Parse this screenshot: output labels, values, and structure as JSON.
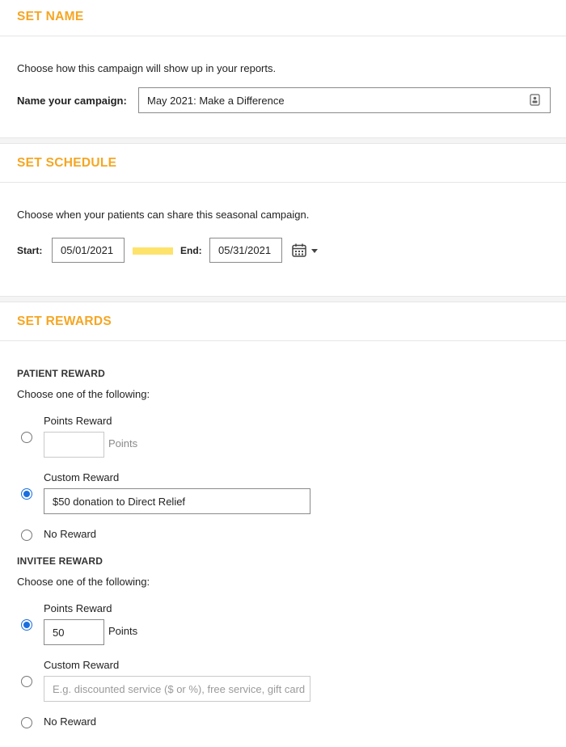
{
  "set_name": {
    "title": "SET NAME",
    "description": "Choose how this campaign will show up in your reports.",
    "label": "Name your campaign:",
    "value": "May 2021: Make a Difference",
    "icon": "contact-card-icon"
  },
  "set_schedule": {
    "title": "SET SCHEDULE",
    "description": "Choose when your patients can share this seasonal campaign.",
    "start_label": "Start:",
    "start_value": "05/01/2021",
    "end_label": "End:",
    "end_value": "05/31/2021",
    "calendar_icon": "calendar-icon",
    "caret_icon": "caret-down-icon"
  },
  "set_rewards": {
    "title": "SET REWARDS",
    "patient": {
      "heading": "PATIENT REWARD",
      "instruction": "Choose one of the following:",
      "points_label": "Points Reward",
      "points_value": "",
      "points_unit": "Points",
      "custom_label": "Custom Reward",
      "custom_value": "$50 donation to Direct Relief",
      "none_label": "No Reward",
      "selected": "custom"
    },
    "invitee": {
      "heading": "INVITEE REWARD",
      "instruction": "Choose one of the following:",
      "points_label": "Points Reward",
      "points_value": "50",
      "points_unit": "Points",
      "custom_label": "Custom Reward",
      "custom_placeholder": "E.g. discounted service ($ or %), free service, gift card",
      "none_label": "No Reward",
      "selected": "points"
    }
  },
  "colors": {
    "accent": "#f5a623",
    "radio_selected": "#1a6ee0",
    "highlight": "#fde36b"
  }
}
